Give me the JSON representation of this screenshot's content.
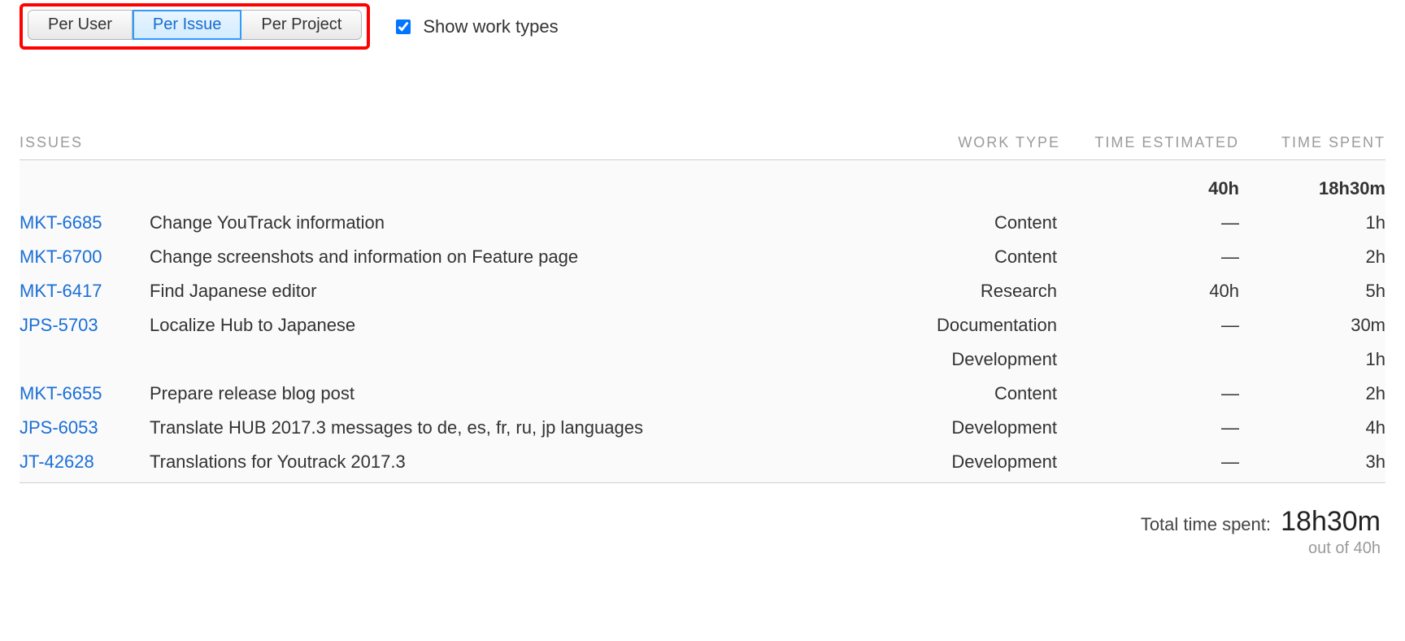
{
  "tabs": {
    "per_user": "Per User",
    "per_issue": "Per Issue",
    "per_project": "Per Project",
    "active": "per_issue"
  },
  "show_work_types": {
    "label": "Show work types",
    "checked": true
  },
  "columns": {
    "issues": "ISSUES",
    "work_type": "WORK TYPE",
    "time_estimated": "TIME ESTIMATED",
    "time_spent": "TIME SPENT"
  },
  "totals_row": {
    "time_estimated": "40h",
    "time_spent": "18h30m"
  },
  "rows": [
    {
      "id": "MKT-6685",
      "title": "Change YouTrack information",
      "work_type": "Content",
      "time_estimated": "—",
      "time_spent": "1h"
    },
    {
      "id": "MKT-6700",
      "title": "Change screenshots and information on Feature page",
      "work_type": "Content",
      "time_estimated": "—",
      "time_spent": "2h"
    },
    {
      "id": "MKT-6417",
      "title": "Find Japanese editor",
      "work_type": "Research",
      "time_estimated": "40h",
      "time_spent": "5h"
    },
    {
      "id": "JPS-5703",
      "title": "Localize Hub to Japanese",
      "work_type": "Documentation",
      "time_estimated": "—",
      "time_spent": "30m"
    },
    {
      "id": "",
      "title": "",
      "work_type": "Development",
      "time_estimated": "",
      "time_spent": "1h"
    },
    {
      "id": "MKT-6655",
      "title": "Prepare release blog post",
      "work_type": "Content",
      "time_estimated": "—",
      "time_spent": "2h"
    },
    {
      "id": "JPS-6053",
      "title": "Translate HUB 2017.3 messages to de, es, fr, ru, jp languages",
      "work_type": "Development",
      "time_estimated": "—",
      "time_spent": "4h"
    },
    {
      "id": "JT-42628",
      "title": "Translations for Youtrack 2017.3",
      "work_type": "Development",
      "time_estimated": "—",
      "time_spent": "3h"
    }
  ],
  "footer": {
    "total_label": "Total time spent:",
    "total_value": "18h30m",
    "out_of": "out of 40h"
  }
}
